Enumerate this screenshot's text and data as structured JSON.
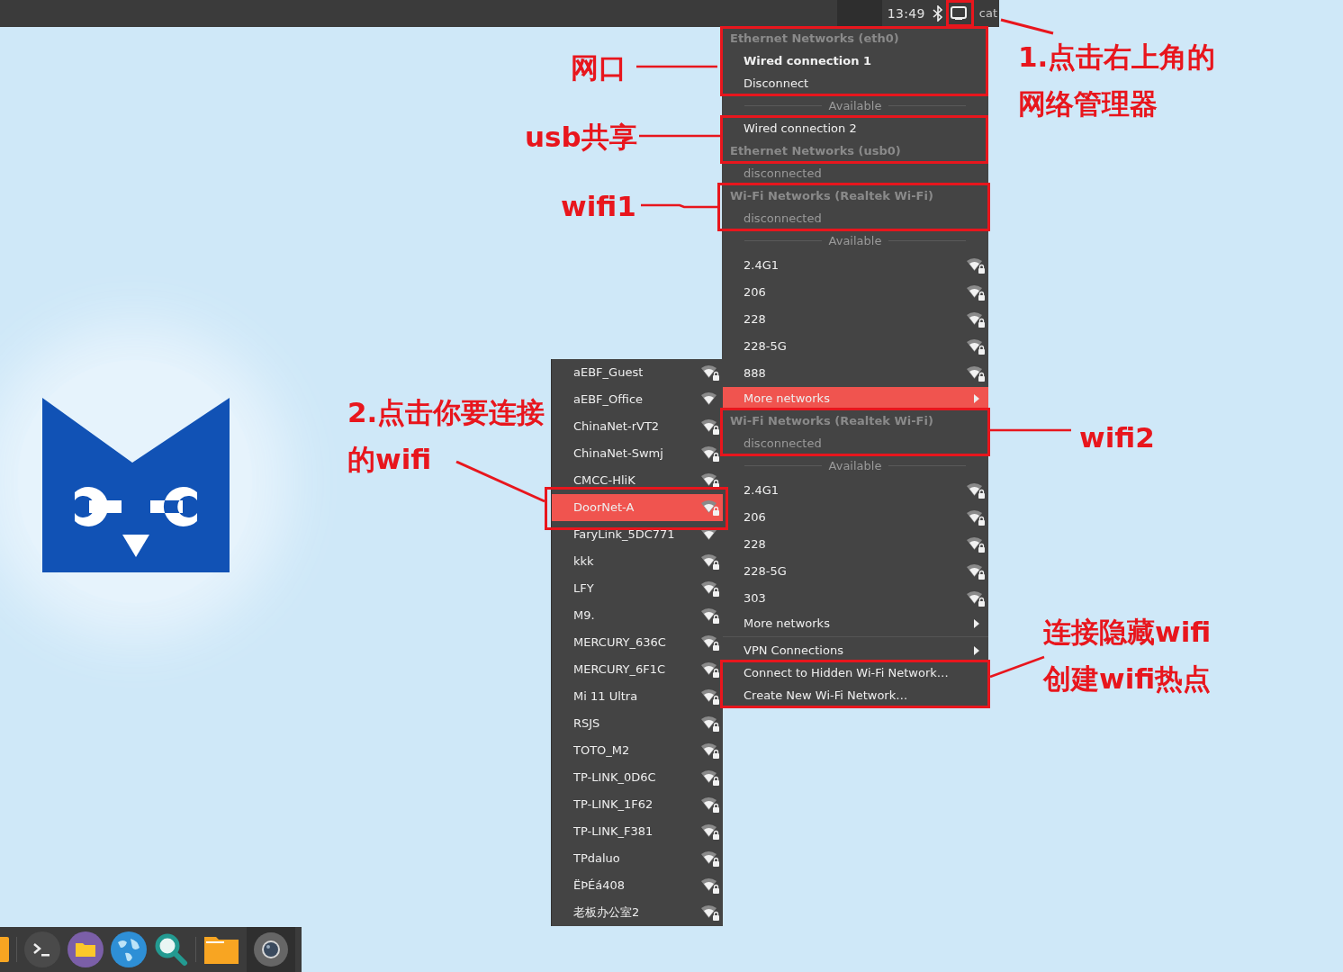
{
  "top_bar": {
    "clock": "13:49",
    "user": "cat"
  },
  "network_menu": [
    {
      "kind": "header",
      "text": "Ethernet Networks (eth0)"
    },
    {
      "kind": "connection",
      "text": "Wired connection 1",
      "active": true
    },
    {
      "kind": "action",
      "text": "Disconnect"
    },
    {
      "kind": "section",
      "text": "Available"
    },
    {
      "kind": "connection",
      "text": "Wired connection 2",
      "active": false
    },
    {
      "kind": "header",
      "text": "Ethernet Networks (usb0)"
    },
    {
      "kind": "status",
      "text": "disconnected"
    },
    {
      "kind": "header",
      "text": "Wi-Fi Networks (Realtek Wi-Fi)"
    },
    {
      "kind": "status",
      "text": "disconnected"
    },
    {
      "kind": "section",
      "text": "Available"
    },
    {
      "kind": "network",
      "text": "2.4G1",
      "locked": true
    },
    {
      "kind": "network",
      "text": "206",
      "locked": true
    },
    {
      "kind": "network",
      "text": "228",
      "locked": true
    },
    {
      "kind": "network",
      "text": "228-5G",
      "locked": true
    },
    {
      "kind": "network",
      "text": "888",
      "locked": true
    },
    {
      "kind": "submenu",
      "text": "More networks",
      "selected": true
    },
    {
      "kind": "header",
      "text": "Wi-Fi Networks (Realtek Wi-Fi)"
    },
    {
      "kind": "status",
      "text": "disconnected"
    },
    {
      "kind": "section",
      "text": "Available"
    },
    {
      "kind": "network",
      "text": "2.4G1",
      "locked": true
    },
    {
      "kind": "network",
      "text": "206",
      "locked": true
    },
    {
      "kind": "network",
      "text": "228",
      "locked": true
    },
    {
      "kind": "network",
      "text": "228-5G",
      "locked": true
    },
    {
      "kind": "network",
      "text": "303",
      "locked": true
    },
    {
      "kind": "submenu",
      "text": "More networks",
      "selected": false
    },
    {
      "kind": "separator"
    },
    {
      "kind": "submenu",
      "text": "VPN Connections",
      "selected": false
    },
    {
      "kind": "action",
      "text": "Connect to Hidden Wi-Fi Network…"
    },
    {
      "kind": "action",
      "text": "Create New Wi-Fi Network…"
    }
  ],
  "more_networks": [
    {
      "name": "aEBF_Guest",
      "locked": true,
      "selected": false
    },
    {
      "name": "aEBF_Office",
      "locked": false,
      "selected": false
    },
    {
      "name": "ChinaNet-rVT2",
      "locked": true,
      "selected": false
    },
    {
      "name": "ChinaNet-Swmj",
      "locked": true,
      "selected": false
    },
    {
      "name": "CMCC-HliK",
      "locked": true,
      "selected": false
    },
    {
      "name": "DoorNet-A",
      "locked": true,
      "selected": true
    },
    {
      "name": "FaryLink_5DC771",
      "locked": false,
      "selected": false
    },
    {
      "name": "kkk",
      "locked": true,
      "selected": false
    },
    {
      "name": "LFY",
      "locked": true,
      "selected": false
    },
    {
      "name": "M9.",
      "locked": true,
      "selected": false
    },
    {
      "name": "MERCURY_636C",
      "locked": true,
      "selected": false
    },
    {
      "name": "MERCURY_6F1C",
      "locked": true,
      "selected": false
    },
    {
      "name": "Mi 11 Ultra",
      "locked": true,
      "selected": false
    },
    {
      "name": "RSJS",
      "locked": true,
      "selected": false
    },
    {
      "name": "TOTO_M2",
      "locked": true,
      "selected": false
    },
    {
      "name": "TP-LINK_0D6C",
      "locked": true,
      "selected": false
    },
    {
      "name": "TP-LINK_1F62",
      "locked": true,
      "selected": false
    },
    {
      "name": "TP-LINK_F381",
      "locked": true,
      "selected": false
    },
    {
      "name": "TPdaluo",
      "locked": true,
      "selected": false
    },
    {
      "name": "ËÞÉá408",
      "locked": true,
      "selected": false
    },
    {
      "name": "老板办公室2",
      "locked": true,
      "selected": false
    }
  ],
  "annotations": [
    {
      "lines": [
        "网口"
      ]
    },
    {
      "lines": [
        "usb共享"
      ]
    },
    {
      "lines": [
        "wifi1"
      ]
    },
    {
      "lines": [
        "1.点击右上角的",
        "网络管理器"
      ]
    },
    {
      "lines": [
        "2.点击你要连接",
        "的wifi"
      ]
    },
    {
      "lines": [
        "wifi2"
      ]
    },
    {
      "lines": [
        "连接隐藏wifi",
        "创建wifi热点"
      ]
    }
  ]
}
